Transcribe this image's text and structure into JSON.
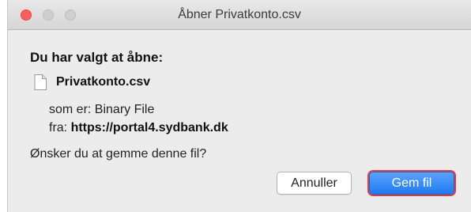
{
  "window": {
    "title": "Åbner Privatkonto.csv"
  },
  "dialog": {
    "heading": "Du har valgt at åbne:",
    "file_name": "Privatkonto.csv",
    "type_label": "som er:",
    "type_value": "Binary File",
    "from_label": "fra:",
    "from_value": "https://portal4.sydbank.dk",
    "question": "Ønsker du at gemme denne fil?"
  },
  "buttons": {
    "cancel": "Annuller",
    "save": "Gem fil"
  },
  "colors": {
    "close_button": "#fc605c",
    "primary_button": "#1f7bf2",
    "focus_ring": "#e53a3a"
  }
}
